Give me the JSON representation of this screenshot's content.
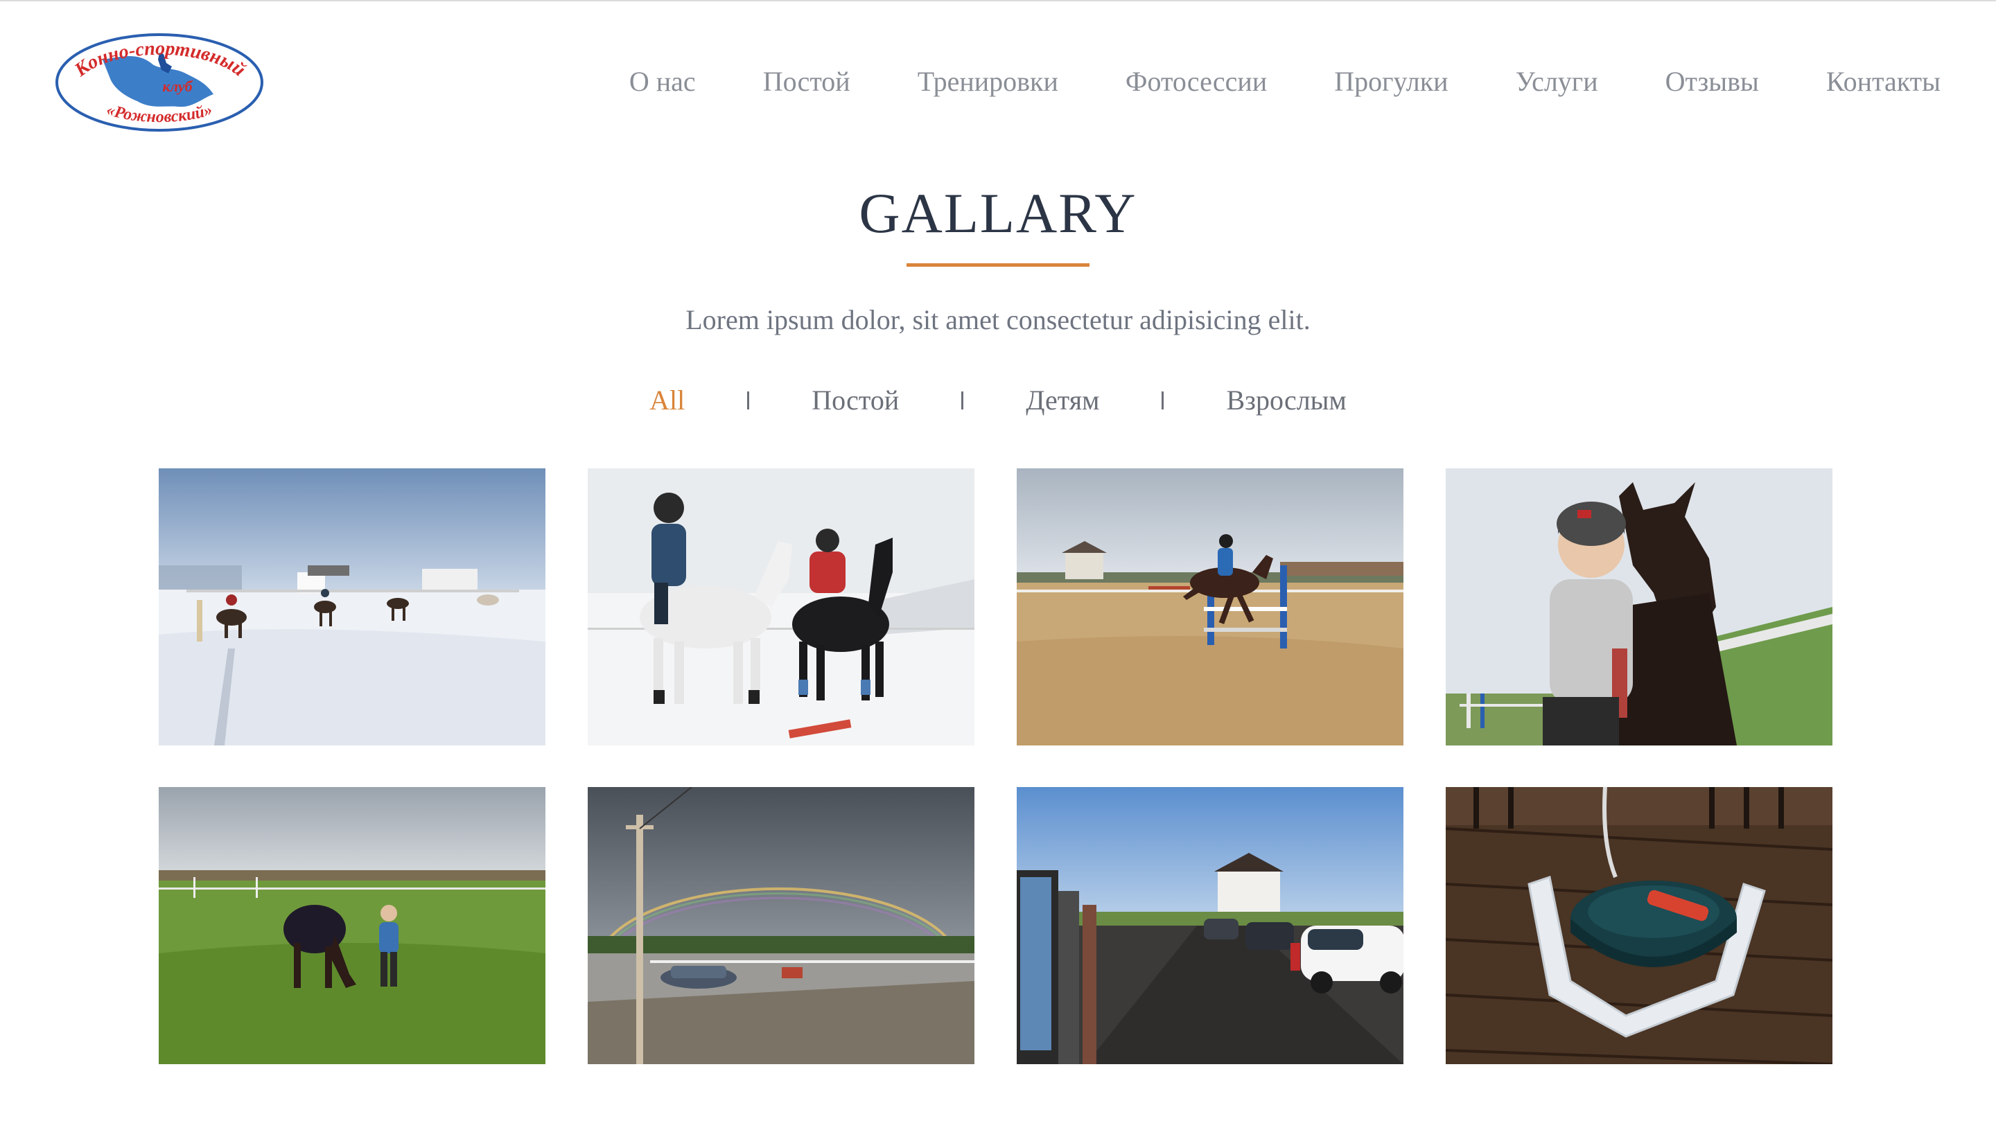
{
  "header": {
    "logo": {
      "text_top": "Конно-спортивный",
      "text_middle": "клуб",
      "text_bottom": "«Рожновский»"
    },
    "nav": [
      {
        "label": "О нас"
      },
      {
        "label": "Постой"
      },
      {
        "label": "Тренировки"
      },
      {
        "label": "Фотосессии"
      },
      {
        "label": "Прогулки"
      },
      {
        "label": "Услуги"
      },
      {
        "label": "Отзывы"
      },
      {
        "label": "Контакты"
      }
    ]
  },
  "section": {
    "title": "GALLARY",
    "subtitle": "Lorem ipsum dolor, sit amet consectetur adipisicing elit."
  },
  "filters": [
    {
      "label": "All",
      "active": true
    },
    {
      "label": "Постой",
      "active": false
    },
    {
      "label": "Детям",
      "active": false
    },
    {
      "label": "Взрослым",
      "active": false
    }
  ],
  "gallery": [
    {
      "scene": "snowy-paddock-riders"
    },
    {
      "scene": "two-riders-snow"
    },
    {
      "scene": "show-jumping-sand-arena"
    },
    {
      "scene": "rider-with-dark-horse-closeup"
    },
    {
      "scene": "horse-grazing-field"
    },
    {
      "scene": "rainbow-parking-lot"
    },
    {
      "scene": "road-with-cars"
    },
    {
      "scene": "stable-water-bowl"
    }
  ],
  "colors": {
    "accent": "#d9843a",
    "title": "#2b3545",
    "nav_text": "#8a8e96",
    "logo_red": "#d42b2b",
    "logo_blue": "#2a5fb0"
  }
}
